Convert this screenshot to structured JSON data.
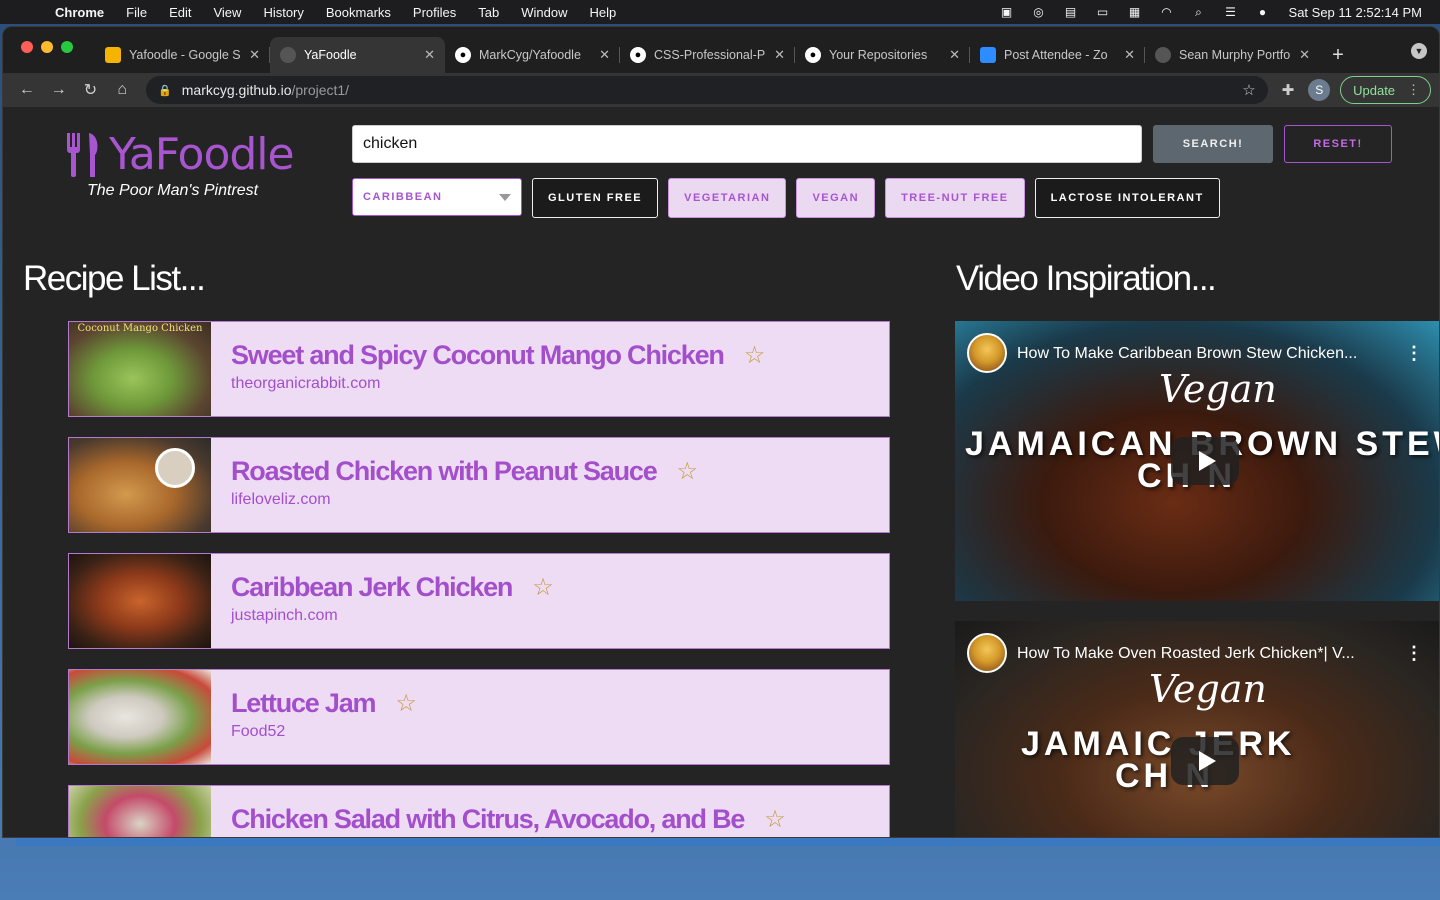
{
  "menubar": {
    "app": "Chrome",
    "items": [
      "File",
      "Edit",
      "View",
      "History",
      "Bookmarks",
      "Profiles",
      "Tab",
      "Window",
      "Help"
    ],
    "clock": "Sat Sep 11  2:52:14 PM"
  },
  "tabs": [
    {
      "title": "Yafoodle - Google S",
      "favicon": "google-sheets-icon",
      "active": false
    },
    {
      "title": "YaFoodle",
      "favicon": "globe-icon",
      "active": true
    },
    {
      "title": "MarkCyg/Yafoodle",
      "favicon": "github-icon",
      "active": false
    },
    {
      "title": "CSS-Professional-P",
      "favicon": "github-icon",
      "active": false
    },
    {
      "title": "Your Repositories",
      "favicon": "github-icon",
      "active": false
    },
    {
      "title": "Post Attendee - Zo",
      "favicon": "zoom-icon",
      "active": false
    },
    {
      "title": "Sean Murphy Portfo",
      "favicon": "globe-icon",
      "active": false
    }
  ],
  "toolbar": {
    "url_host": "markcyg.github.io",
    "url_path": "/project1/",
    "avatar_letter": "S",
    "update_label": "Update"
  },
  "page": {
    "logo_text": "YaFoodle",
    "tagline": "The Poor Man's Pintrest",
    "search_value": "chicken",
    "search_button": "SEARCH!",
    "reset_button": "RESET!",
    "cuisine_selected": "CARIBBEAN",
    "filters": [
      {
        "label": "GLUTEN FREE",
        "active": true
      },
      {
        "label": "VEGETARIAN",
        "active": false
      },
      {
        "label": "VEGAN",
        "active": false
      },
      {
        "label": "TREE-NUT FREE",
        "active": false
      },
      {
        "label": "LACTOSE INTOLERANT",
        "active": true
      }
    ],
    "recipe_heading": "Recipe List...",
    "video_heading": "Video Inspiration..."
  },
  "recipes": [
    {
      "title": "Sweet and Spicy Coconut Mango Chicken",
      "source": "theorganicrabbit.com",
      "thumb_caption": "Coconut Mango Chicken"
    },
    {
      "title": "Roasted Chicken with Peanut Sauce",
      "source": "lifeloveliz.com",
      "thumb_caption": ""
    },
    {
      "title": "Caribbean Jerk Chicken",
      "source": "justapinch.com",
      "thumb_caption": ""
    },
    {
      "title": "Lettuce Jam",
      "source": "Food52",
      "thumb_caption": ""
    },
    {
      "title": "Chicken Salad with Citrus, Avocado, and Be",
      "source": "",
      "thumb_caption": ""
    }
  ],
  "videos": [
    {
      "title": "How To Make Caribbean Brown Stew Chicken...",
      "script": "Vegan",
      "overlay1": "JAMAICAN BROWN STEW",
      "overlay2": "CH    N"
    },
    {
      "title": "How To Make Oven Roasted Jerk Chicken*| V...",
      "script": "Vegan",
      "overlay1": "JAMAIC    JERK",
      "overlay2": "CH    N"
    }
  ],
  "colors": {
    "accent_purple": "#a855d0",
    "card_bg": "#eedcf5",
    "page_bg": "#242424",
    "star_gold": "#c79a3f"
  }
}
